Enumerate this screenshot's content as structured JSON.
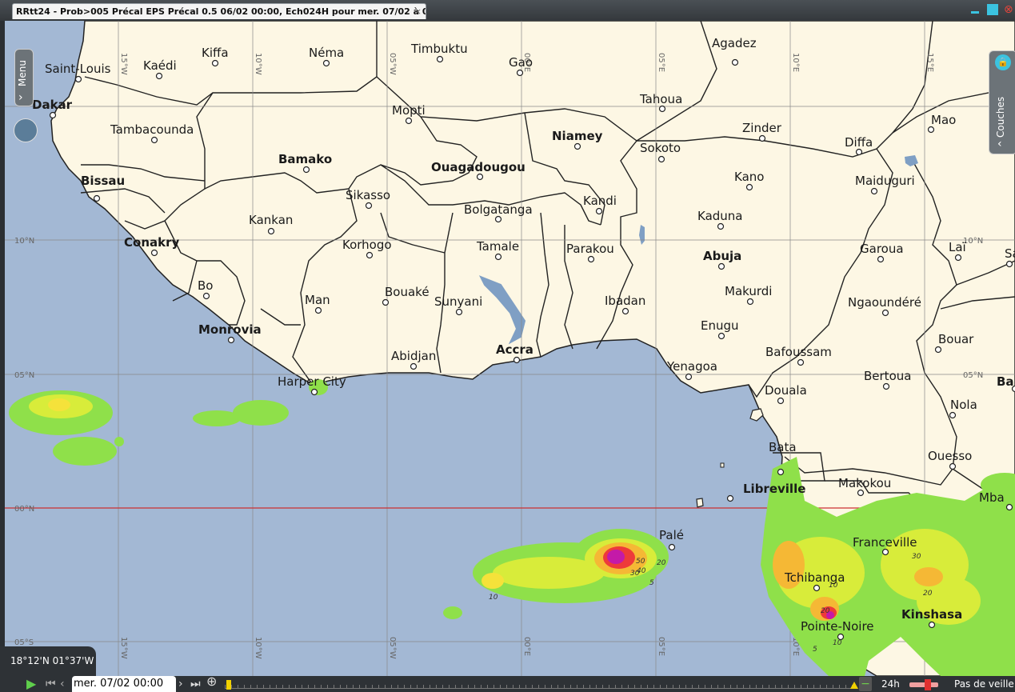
{
  "window": {
    "tab_title": "RRtt24 - Prob>005 Précal EPS Précal 0.5 06/02 00:00, Ech024H pour mer. 07/02 à 00:00UTC",
    "tab_close": "×",
    "close": "⊗"
  },
  "map": {
    "grid_labels_lon": [
      "15°W",
      "10°W",
      "05°W",
      "00°E",
      "05°E",
      "10°E",
      "15°E"
    ],
    "grid_labels_lat": [
      "10°N",
      "05°N",
      "00°N",
      "05°S"
    ],
    "cities": [
      {
        "name": "Saint-Louis",
        "bold": false
      },
      {
        "name": "Dakar",
        "bold": true
      },
      {
        "name": "Kaédi",
        "bold": false
      },
      {
        "name": "Kiffa",
        "bold": false
      },
      {
        "name": "Néma",
        "bold": false
      },
      {
        "name": "Timbuktu",
        "bold": false
      },
      {
        "name": "Gao",
        "bold": false
      },
      {
        "name": "Agadez",
        "bold": false
      },
      {
        "name": "Tambacounda",
        "bold": false
      },
      {
        "name": "Mopti",
        "bold": false
      },
      {
        "name": "Tahoua",
        "bold": false
      },
      {
        "name": "Niamey",
        "bold": true
      },
      {
        "name": "Zinder",
        "bold": false
      },
      {
        "name": "Diffa",
        "bold": false
      },
      {
        "name": "Mao",
        "bold": false
      },
      {
        "name": "Bamako",
        "bold": true
      },
      {
        "name": "Ouagadougou",
        "bold": true
      },
      {
        "name": "Sokoto",
        "bold": false
      },
      {
        "name": "Bissau",
        "bold": true
      },
      {
        "name": "Sikasso",
        "bold": false
      },
      {
        "name": "Kano",
        "bold": false
      },
      {
        "name": "Maiduguri",
        "bold": false
      },
      {
        "name": "Kandi",
        "bold": false
      },
      {
        "name": "Bolgatanga",
        "bold": false
      },
      {
        "name": "Kankan",
        "bold": false
      },
      {
        "name": "Kaduna",
        "bold": false
      },
      {
        "name": "Conakry",
        "bold": true
      },
      {
        "name": "Korhogo",
        "bold": false
      },
      {
        "name": "Tamale",
        "bold": false
      },
      {
        "name": "Parakou",
        "bold": false
      },
      {
        "name": "Garoua",
        "bold": false
      },
      {
        "name": "Laï",
        "bold": false
      },
      {
        "name": "Abuja",
        "bold": true
      },
      {
        "name": "Bo",
        "bold": false
      },
      {
        "name": "Man",
        "bold": false
      },
      {
        "name": "Bouaké",
        "bold": false
      },
      {
        "name": "Sunyani",
        "bold": false
      },
      {
        "name": "Ibadan",
        "bold": false
      },
      {
        "name": "Makurdi",
        "bold": false
      },
      {
        "name": "Ngaoundéré",
        "bold": false
      },
      {
        "name": "Monrovia",
        "bold": true
      },
      {
        "name": "Enugu",
        "bold": false
      },
      {
        "name": "Bouar",
        "bold": false
      },
      {
        "name": "Abidjan",
        "bold": false
      },
      {
        "name": "Accra",
        "bold": true
      },
      {
        "name": "Bafoussam",
        "bold": false
      },
      {
        "name": "Yenagoa",
        "bold": false
      },
      {
        "name": "Harper City",
        "bold": false
      },
      {
        "name": "Bertoua",
        "bold": false
      },
      {
        "name": "Douala",
        "bold": false
      },
      {
        "name": "Nola",
        "bold": false
      },
      {
        "name": "Bata",
        "bold": false
      },
      {
        "name": "Ouesso",
        "bold": false
      },
      {
        "name": "Libreville",
        "bold": true
      },
      {
        "name": "Makokou",
        "bold": false
      },
      {
        "name": "Palé",
        "bold": false
      },
      {
        "name": "Franceville",
        "bold": false
      },
      {
        "name": "Tchibanga",
        "bold": false
      },
      {
        "name": "Kinshasa",
        "bold": true
      },
      {
        "name": "Pointe-Noire",
        "bold": false
      },
      {
        "name": "Sa",
        "bold": false
      },
      {
        "name": "Ba",
        "bold": true
      },
      {
        "name": "Mba",
        "bold": false
      },
      {
        "name": "A",
        "bold": false
      }
    ],
    "contour_labels": [
      "50",
      "40",
      "30",
      "20",
      "10",
      "5",
      "10",
      "20",
      "30",
      "20",
      "5",
      "10"
    ]
  },
  "controls": {
    "menu_label": "Menu",
    "layers_label": "Couches",
    "coordinates": "18°12'N 01°37'W"
  },
  "toolbar": {
    "date": "mer. 07/02 00:00",
    "step": "24h",
    "mode": "Pas de veille"
  }
}
